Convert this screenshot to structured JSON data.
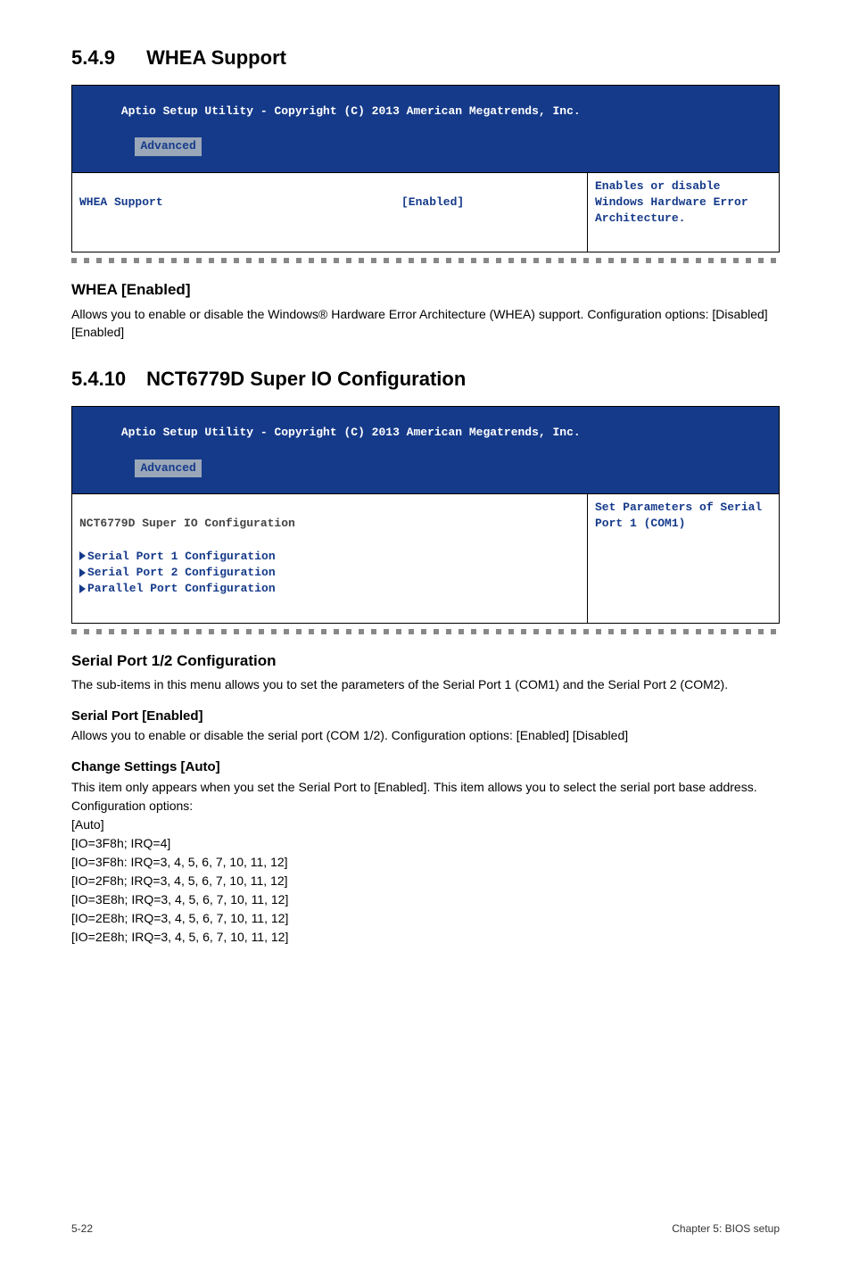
{
  "section1": {
    "num": "5.4.9",
    "title": "WHEA Support"
  },
  "bios1": {
    "header_line": "  Aptio Setup Utility - Copyright (C) 2013 American Megatrends, Inc.",
    "tab": "Advanced",
    "left_key": "WHEA Support",
    "left_val": "[Enabled]",
    "right": "Enables or disable Windows Hardware Error Architecture."
  },
  "whea_block": {
    "heading": "WHEA [Enabled]",
    "body": "Allows you to enable or disable the Windows® Hardware Error Architecture (WHEA) support. Configuration options: [Disabled] [Enabled]"
  },
  "section2": {
    "num": "5.4.10",
    "title": "NCT6779D Super IO Configuration"
  },
  "bios2": {
    "header_line": "  Aptio Setup Utility - Copyright (C) 2013 American Megatrends, Inc.",
    "tab": "Advanced",
    "left_heading": "NCT6779D Super IO Configuration",
    "items": {
      "a": "Serial Port 1 Configuration",
      "b": "Serial Port 2 Configuration",
      "c": "Parallel Port Configuration"
    },
    "right": "Set Parameters of Serial Port 1 (COM1)"
  },
  "serial_block": {
    "heading": "Serial Port 1/2 Configuration",
    "body": "The sub-items in this menu allows you to set the parameters of the Serial Port 1 (COM1) and the Serial Port 2 (COM2).",
    "sp_heading": "Serial Port [Enabled]",
    "sp_body": "Allows you to enable or disable the serial port (COM 1/2). Configuration options: [Enabled] [Disabled]",
    "cs_heading": "Change Settings [Auto]",
    "cs_intro": "This item only appears when you set the Serial Port to [Enabled]. This item allows you to select the serial port base address. Configuration options:",
    "opts": {
      "o1": "[Auto]",
      "o2": "[IO=3F8h; IRQ=4]",
      "o3": "[IO=3F8h: IRQ=3, 4, 5, 6, 7, 10, 11, 12]",
      "o4": "[IO=2F8h; IRQ=3, 4, 5, 6, 7, 10, 11, 12]",
      "o5": "[IO=3E8h; IRQ=3, 4, 5, 6, 7, 10, 11, 12]",
      "o6": "[IO=2E8h; IRQ=3, 4, 5, 6, 7, 10, 11, 12]",
      "o7": "[IO=2E8h; IRQ=3, 4, 5, 6, 7, 10, 11, 12]"
    }
  },
  "footer": {
    "left": "5-22",
    "right": "Chapter 5: BIOS setup"
  }
}
